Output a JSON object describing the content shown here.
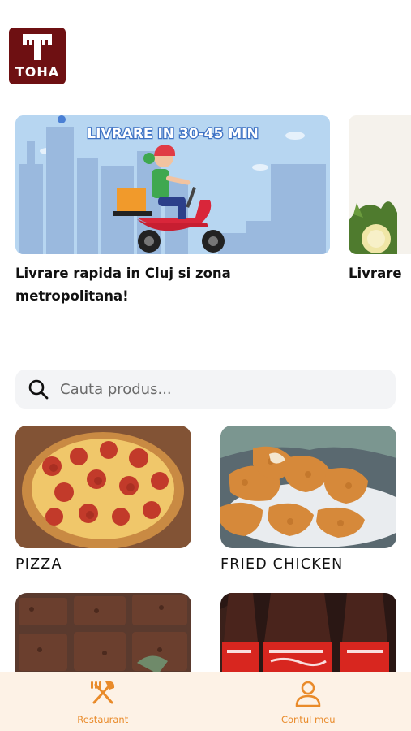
{
  "app": {
    "logo_text": "TOHA",
    "brand_color": "#6e1012",
    "accent_color": "#e98b2a"
  },
  "promos": [
    {
      "banner_text": "LIVRARE IN 30-45 MIN",
      "caption": "Livrare rapida in Cluj si zona metropolitana!"
    },
    {
      "caption": "Livrare"
    }
  ],
  "search": {
    "placeholder": "Cauta produs...",
    "icon": "search-icon"
  },
  "categories": [
    {
      "label": "PIZZA"
    },
    {
      "label": "FRIED CHICKEN"
    },
    {
      "label": ""
    },
    {
      "label": ""
    }
  ],
  "bottom_nav": {
    "items": [
      {
        "label": "Restaurant",
        "icon": "fork-knife-icon"
      },
      {
        "label": "Contul meu",
        "icon": "user-icon"
      }
    ]
  }
}
